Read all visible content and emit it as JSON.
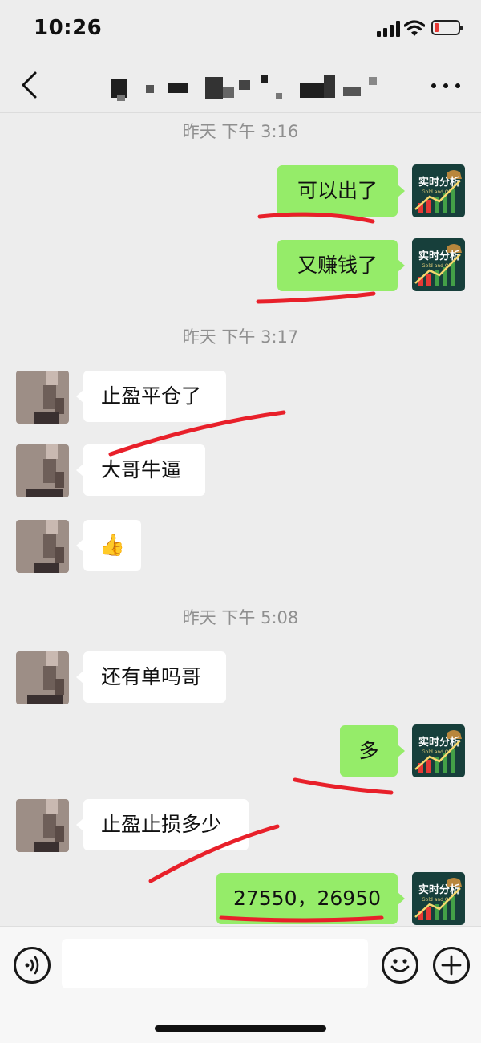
{
  "status_bar": {
    "time": "10:26",
    "battery_level": 0.15,
    "battery_color": "#e53935"
  },
  "header": {
    "back_icon": "chevron-left-icon",
    "title_obscured": true,
    "more_icon": "ellipsis-icon"
  },
  "timestamps": [
    "昨天 下午 3:16",
    "昨天 下午 3:17",
    "昨天 下午 5:08"
  ],
  "messages": [
    {
      "side": "out",
      "text": "可以出了"
    },
    {
      "side": "out",
      "text": "又赚钱了"
    },
    {
      "side": "in",
      "text": "止盈平仓了"
    },
    {
      "side": "in",
      "text": "大哥牛逼"
    },
    {
      "side": "in",
      "text": "👍"
    },
    {
      "side": "in",
      "text": "还有单吗哥"
    },
    {
      "side": "out",
      "text": "多"
    },
    {
      "side": "in",
      "text": "止盈止损多少"
    },
    {
      "side": "out",
      "text": "27550，26950"
    }
  ],
  "self_avatar": {
    "text": "实时分析",
    "subtext": "Gold and Oil"
  },
  "input_bar": {
    "voice_icon": "voice-icon",
    "emoji_icon": "emoji-icon",
    "plus_icon": "plus-icon"
  },
  "colors": {
    "outgoing_bubble": "#95ec69",
    "incoming_bubble": "#ffffff",
    "background": "#ededed",
    "annotation": "#e8202a"
  }
}
